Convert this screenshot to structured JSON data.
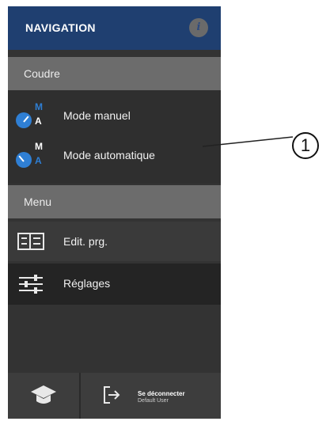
{
  "header": {
    "title": "NAVIGATION",
    "info_glyph": "i"
  },
  "sections": {
    "coudre": "Coudre",
    "menu": "Menu"
  },
  "coudre_items": [
    {
      "label": "Mode manuel",
      "icon": "mode-manuel-icon",
      "m": "M",
      "a": "A"
    },
    {
      "label": "Mode automatique",
      "icon": "mode-automatique-icon",
      "m": "M",
      "a": "A"
    }
  ],
  "menu_items": [
    {
      "label": "Edit. prg.",
      "icon": "edit-program-icon"
    },
    {
      "label": "Réglages",
      "icon": "settings-sliders-icon"
    }
  ],
  "footer": {
    "logout_title": "Se déconnecter",
    "logout_user": "Default User"
  },
  "callout": {
    "number": "1"
  },
  "colors": {
    "header": "#1f3f70",
    "accent": "#2f7fd4",
    "panel": "#333333",
    "section": "#6c6c6c"
  }
}
